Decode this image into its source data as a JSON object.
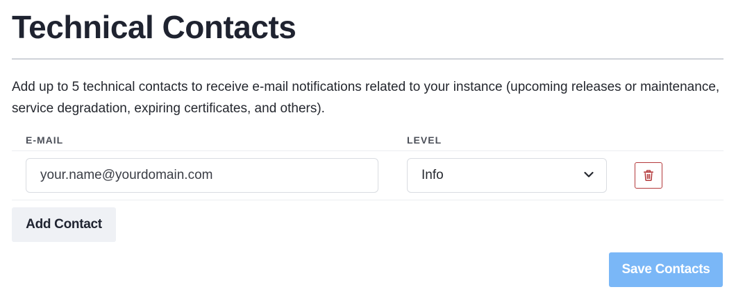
{
  "header": {
    "title": "Technical Contacts"
  },
  "description": "Add up to 5 technical contacts to receive e-mail notifications related to your instance (upcoming releases or maintenance, service degradation, expiring certificates, and others).",
  "table": {
    "columns": {
      "email": "E-MAIL",
      "level": "LEVEL"
    },
    "rows": [
      {
        "email_value": "",
        "email_placeholder": "your.name@yourdomain.com",
        "level": "Info"
      }
    ]
  },
  "actions": {
    "add_label": "Add Contact",
    "save_label": "Save Contacts"
  },
  "icons": {
    "chevron": "chevron-down-icon",
    "delete": "trash-icon"
  },
  "colors": {
    "save_button": "#7ab7f7",
    "delete_border": "#b3383a",
    "add_button_bg": "#eff1f5"
  }
}
